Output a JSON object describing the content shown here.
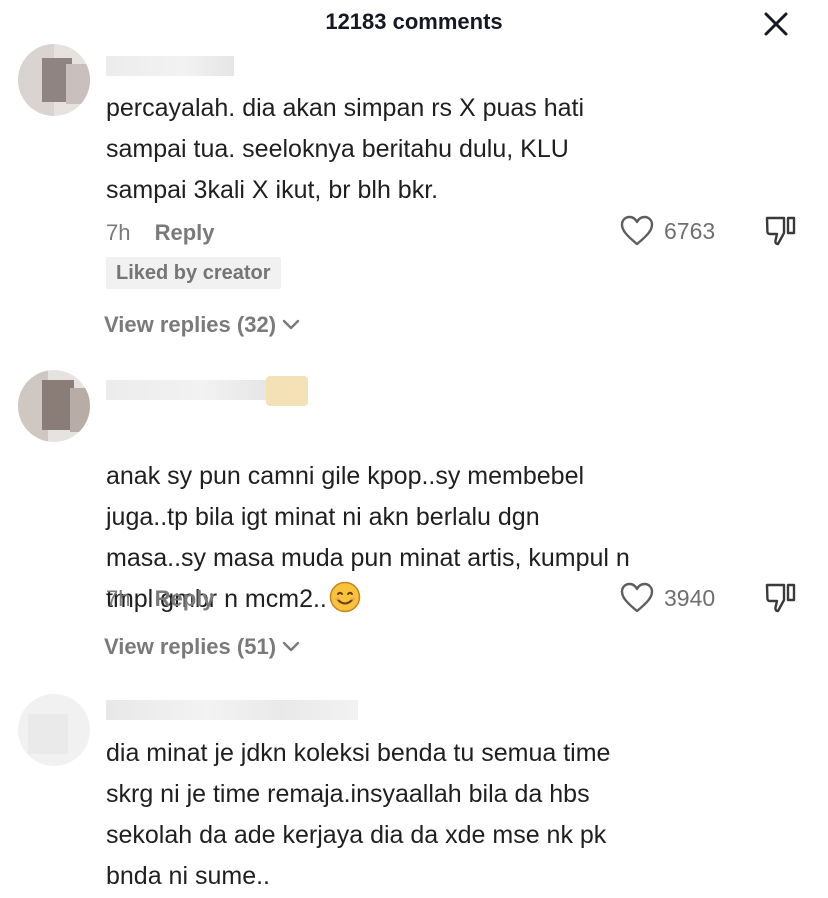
{
  "header": {
    "title": "12183 comments",
    "close_icon": "close-icon"
  },
  "comments": [
    {
      "text": "percayalah. dia akan simpan rs X puas hati\nsampai tua. seeloknya beritahu dulu, KLU\nsampai 3kali X ikut, br blh bkr.",
      "time": "7h",
      "reply_label": "Reply",
      "likes": "6763",
      "badge": "Liked by creator",
      "view_replies": "View replies (32)"
    },
    {
      "text": "anak sy pun camni gile kpop..sy membebel\njuga..tp bila igt minat ni akn berlalu dgn\nmasa..sy masa muda pun minat artis, kumpul n\ntmpl gmbr n mcm2..",
      "emoji": "smiling-face-emoji",
      "time": "7h",
      "reply_label": "Reply",
      "likes": "3940",
      "view_replies": "View replies (51)"
    },
    {
      "text": "dia minat je jdkn koleksi benda tu semua time\nskrg ni je time remaja.insyaallah bila da hbs\nsekolah da ade kerjaya dia da xde mse nk pk\nbnda ni sume.."
    }
  ],
  "colors": {
    "text": "#1f1f1f",
    "muted": "#7a7a7a",
    "badge_bg": "#f1f1f2"
  }
}
